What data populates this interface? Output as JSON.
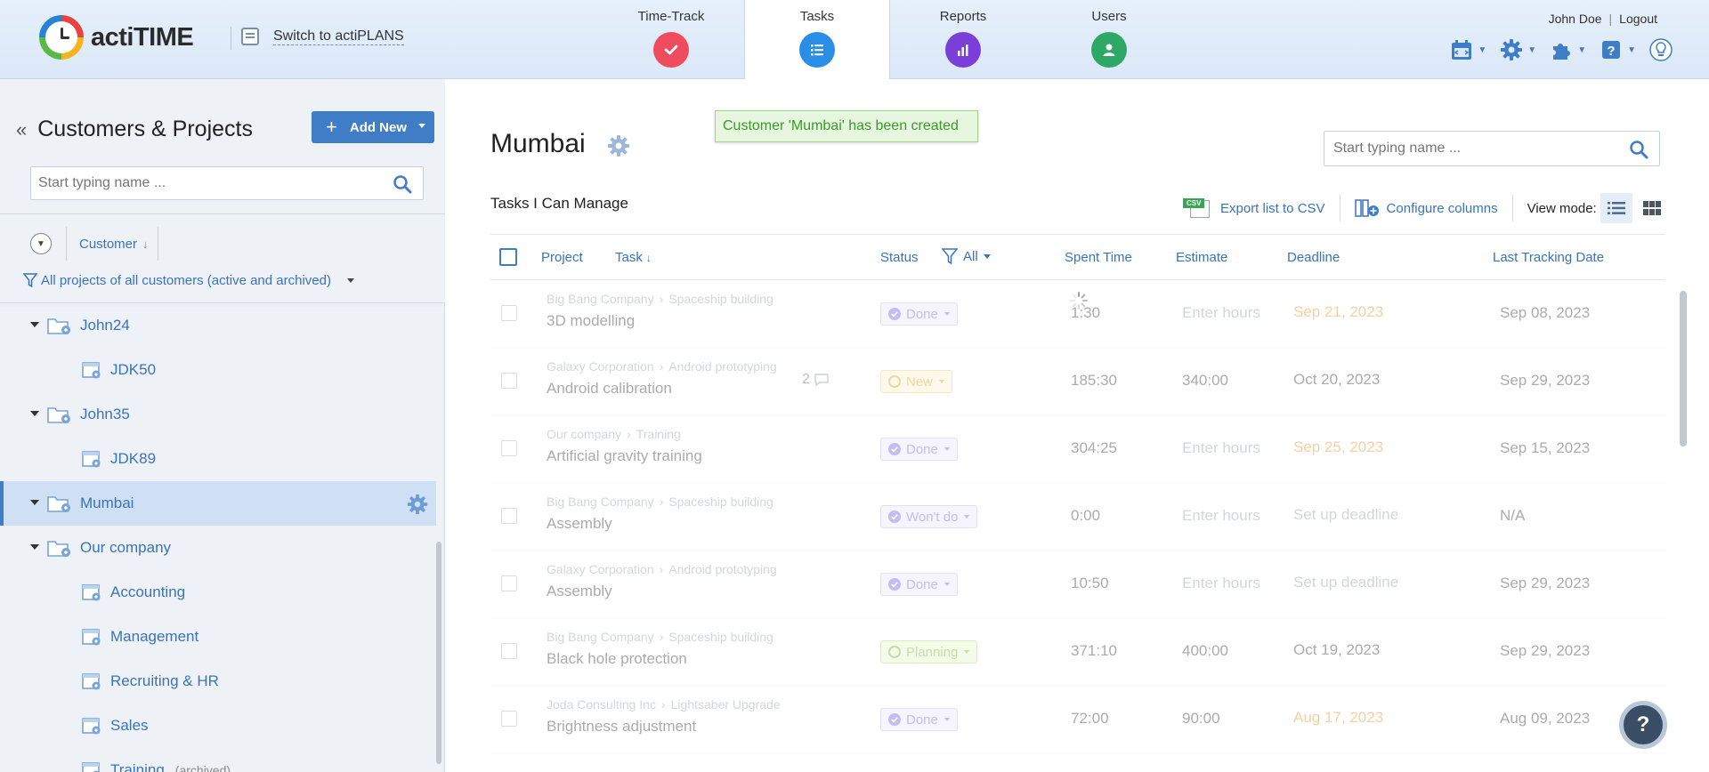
{
  "header": {
    "logo_text": "actiTIME",
    "switch_label": "Switch to actiPLANS",
    "nav": [
      {
        "label": "Time-Track",
        "icon": "time-track-icon"
      },
      {
        "label": "Tasks",
        "icon": "tasks-icon",
        "active": true
      },
      {
        "label": "Reports",
        "icon": "reports-icon"
      },
      {
        "label": "Users",
        "icon": "users-icon"
      }
    ],
    "user_name": "John Doe",
    "logout": "Logout",
    "tools": [
      "calendar-icon",
      "settings-icon",
      "addons-icon",
      "help-icon",
      "idea-icon"
    ]
  },
  "sidebar": {
    "title": "Customers & Projects",
    "add_new": "Add New",
    "search_placeholder": "Start typing name ...",
    "sort_label": "Customer",
    "filter_label": "All projects of all customers (active and archived)",
    "tree": [
      {
        "label": "John24",
        "level": 0
      },
      {
        "label": "JDK50",
        "level": 1
      },
      {
        "label": "John35",
        "level": 0
      },
      {
        "label": "JDK89",
        "level": 1
      },
      {
        "label": "Mumbai",
        "level": 0,
        "selected": true
      },
      {
        "label": "Our company",
        "level": 0
      },
      {
        "label": "Accounting",
        "level": 1
      },
      {
        "label": "Management",
        "level": 1
      },
      {
        "label": "Recruiting & HR",
        "level": 1
      },
      {
        "label": "Sales",
        "level": 1
      },
      {
        "label": "Training",
        "level": 1,
        "suffix": "(archived)"
      }
    ]
  },
  "main": {
    "title": "Mumbai",
    "toast": "Customer 'Mumbai' has been created",
    "search_placeholder": "Start typing name ...",
    "section_title": "Tasks I Can Manage",
    "export_label": "Export list to CSV",
    "csv_tag": "CSV",
    "configure_label": "Configure columns",
    "view_mode_label": "View mode:",
    "columns": {
      "project": "Project",
      "task": "Task",
      "status": "Status",
      "status_filter": "All",
      "spent": "Spent Time",
      "estimate": "Estimate",
      "deadline": "Deadline",
      "last_tracking": "Last Tracking Date"
    },
    "rows": [
      {
        "customer": "Big Bang Company",
        "project": "Spaceship building",
        "task": "3D modelling",
        "status": "Done",
        "status_kind": "done",
        "spent": "1:30",
        "estimate": "Enter hours",
        "estimate_placeholder": true,
        "deadline": "Sep 21, 2023",
        "deadline_kind": "late",
        "last": "Sep 08, 2023"
      },
      {
        "customer": "Galaxy Corporation",
        "project": "Android prototyping",
        "task": "Android calibration",
        "comments": "2",
        "status": "New",
        "status_kind": "new",
        "spent": "185:30",
        "estimate": "340:00",
        "deadline": "Oct 20, 2023",
        "deadline_kind": "normal",
        "last": "Sep 29, 2023"
      },
      {
        "customer": "Our company",
        "project": "Training",
        "task": "Artificial gravity training",
        "status": "Done",
        "status_kind": "done",
        "spent": "304:25",
        "estimate": "Enter hours",
        "estimate_placeholder": true,
        "deadline": "Sep 25, 2023",
        "deadline_kind": "late",
        "last": "Sep 15, 2023"
      },
      {
        "customer": "Big Bang Company",
        "project": "Spaceship building",
        "task": "Assembly",
        "status": "Won't do",
        "status_kind": "done",
        "spent": "0:00",
        "estimate": "Enter hours",
        "estimate_placeholder": true,
        "deadline": "Set up deadline",
        "deadline_kind": "placeholder",
        "last": "N/A"
      },
      {
        "customer": "Galaxy Corporation",
        "project": "Android prototyping",
        "task": "Assembly",
        "status": "Done",
        "status_kind": "done",
        "spent": "10:50",
        "estimate": "Enter hours",
        "estimate_placeholder": true,
        "deadline": "Set up deadline",
        "deadline_kind": "placeholder",
        "last": "Sep 29, 2023"
      },
      {
        "customer": "Big Bang Company",
        "project": "Spaceship building",
        "task": "Black hole protection",
        "status": "Planning",
        "status_kind": "plan",
        "spent": "371:10",
        "estimate": "400:00",
        "deadline": "Oct 19, 2023",
        "deadline_kind": "normal",
        "last": "Sep 29, 2023"
      },
      {
        "customer": "Joda Consulting Inc",
        "project": "Lightsaber Upgrade",
        "task": "Brightness adjustment",
        "status": "Done",
        "status_kind": "done",
        "spent": "72:00",
        "estimate": "90:00",
        "deadline": "Aug 17, 2023",
        "deadline_kind": "late",
        "last": "Aug 09, 2023"
      }
    ],
    "help_label": "?"
  },
  "colors": {
    "accent": "#3f7dc6",
    "link": "#3b73b9",
    "late_deadline": "#f0800c",
    "toast_bg": "#e6f6df",
    "toast_text": "#3c9a2b"
  }
}
